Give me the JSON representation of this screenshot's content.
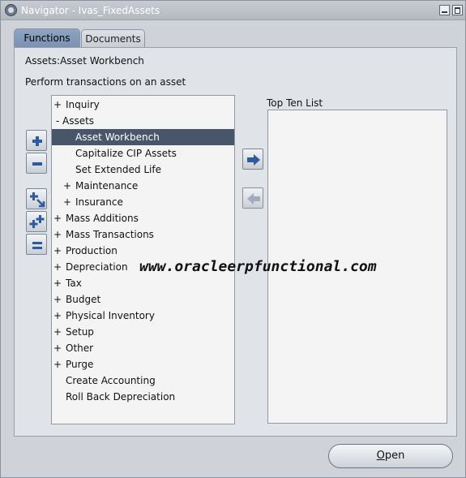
{
  "window": {
    "title": "Navigator - Ivas_FixedAssets",
    "minimize_icon": "minimize-icon",
    "maximize_icon": "maximize-icon"
  },
  "tabs": [
    {
      "label": "Functions",
      "active": true
    },
    {
      "label": "Documents",
      "active": false
    }
  ],
  "context_label": "Assets:Asset Workbench",
  "instruction": "Perform transactions on an asset",
  "tree": [
    {
      "marker": "+",
      "label": "Inquiry",
      "level": 0
    },
    {
      "marker": "-",
      "label": "Assets",
      "level": 0
    },
    {
      "marker": "",
      "label": "Asset Workbench",
      "level": 1,
      "selected": true
    },
    {
      "marker": "",
      "label": "Capitalize CIP Assets",
      "level": 1
    },
    {
      "marker": "",
      "label": "Set Extended Life",
      "level": 1
    },
    {
      "marker": "+",
      "label": "Maintenance",
      "level": 1
    },
    {
      "marker": "+",
      "label": "Insurance",
      "level": 1
    },
    {
      "marker": "+",
      "label": "Mass Additions",
      "level": 0
    },
    {
      "marker": "+",
      "label": "Mass Transactions",
      "level": 0
    },
    {
      "marker": "+",
      "label": "Production",
      "level": 0
    },
    {
      "marker": "+",
      "label": "Depreciation",
      "level": 0
    },
    {
      "marker": "+",
      "label": "Tax",
      "level": 0
    },
    {
      "marker": "+",
      "label": "Budget",
      "level": 0
    },
    {
      "marker": "+",
      "label": "Physical Inventory",
      "level": 0
    },
    {
      "marker": "+",
      "label": "Setup",
      "level": 0
    },
    {
      "marker": "+",
      "label": "Other",
      "level": 0
    },
    {
      "marker": "+",
      "label": "Purge",
      "level": 0
    },
    {
      "marker": "",
      "label": "Create Accounting",
      "level": 0
    },
    {
      "marker": "",
      "label": "Roll Back Depreciation",
      "level": 0
    }
  ],
  "top_ten": {
    "label": "Top Ten List",
    "items": []
  },
  "tree_buttons": [
    "expand-icon",
    "collapse-icon",
    "expand-branch-icon",
    "expand-all-icon",
    "collapse-all-icon"
  ],
  "list_buttons": [
    "arrow-right-icon",
    "arrow-left-icon"
  ],
  "watermark": "www.oracleerpfunctional.com",
  "open_button": {
    "label_underlined": "O",
    "label_rest": "pen"
  },
  "colors": {
    "selected_row": "#49566a",
    "active_tab": "#8ea4c2",
    "arrow": "#2f5a9e"
  }
}
